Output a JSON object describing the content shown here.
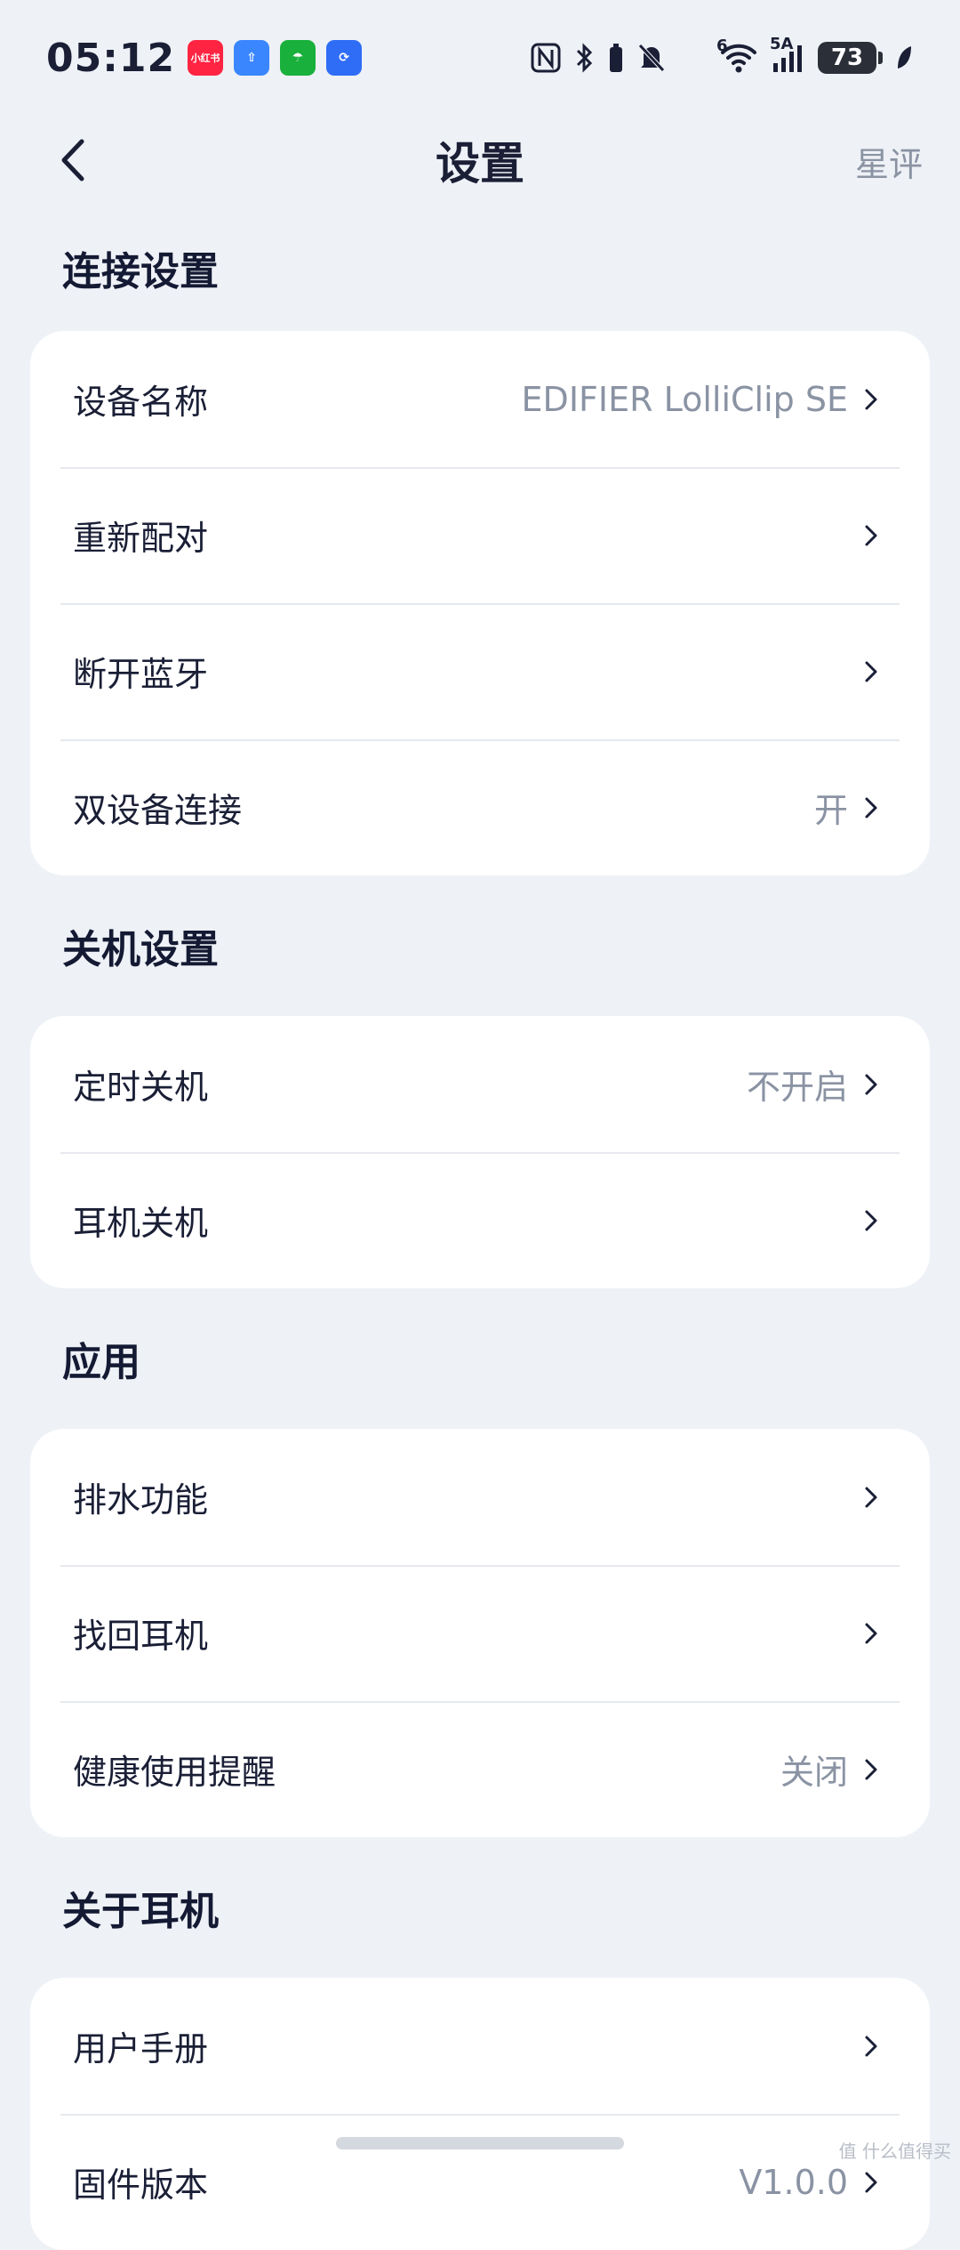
{
  "status": {
    "time": "05:12",
    "battery": "73",
    "network_label": "5A",
    "wifi_label": "6",
    "app_icons": [
      {
        "label": "小红书",
        "color": "#ff2442"
      },
      {
        "label": "⇧",
        "color": "#3a86ff"
      },
      {
        "label": "☂",
        "color": "#19b03b"
      },
      {
        "label": "⟳",
        "color": "#2f6df6"
      }
    ]
  },
  "nav": {
    "title": "设置",
    "right_action": "星评"
  },
  "sections": [
    {
      "title": "连接设置",
      "rows": [
        {
          "label": "设备名称",
          "value": "EDIFIER LolliClip SE"
        },
        {
          "label": "重新配对",
          "value": ""
        },
        {
          "label": "断开蓝牙",
          "value": ""
        },
        {
          "label": "双设备连接",
          "value": "开"
        }
      ]
    },
    {
      "title": "关机设置",
      "rows": [
        {
          "label": "定时关机",
          "value": "不开启"
        },
        {
          "label": "耳机关机",
          "value": ""
        }
      ]
    },
    {
      "title": "应用",
      "rows": [
        {
          "label": "排水功能",
          "value": ""
        },
        {
          "label": "找回耳机",
          "value": ""
        },
        {
          "label": "健康使用提醒",
          "value": "关闭"
        }
      ]
    },
    {
      "title": "关于耳机",
      "rows": [
        {
          "label": "用户手册",
          "value": ""
        },
        {
          "label": "固件版本",
          "value": "V1.0.0"
        }
      ]
    }
  ],
  "watermark": "值 什么值得买",
  "colors": {
    "background": "#eef1f6",
    "card": "#ffffff",
    "text_primary": "#1a1f36",
    "text_secondary": "#8a93a3"
  }
}
